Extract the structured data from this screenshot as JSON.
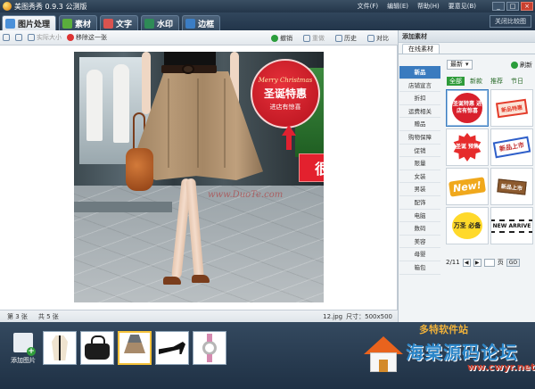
{
  "window": {
    "title": "美图秀秀 0.9.3 公测版",
    "menus": [
      "文件(F)",
      "编辑(E)",
      "帮助(H)",
      "要意见(B)"
    ],
    "controls": [
      "_",
      "□",
      "×"
    ]
  },
  "tabs": [
    {
      "label": "图片处理",
      "icon_color": "#4a90d9"
    },
    {
      "label": "素材",
      "icon_color": "#5aae3c"
    },
    {
      "label": "文字",
      "icon_color": "#d9534f"
    },
    {
      "label": "水印",
      "icon_color": "#2e8b57"
    },
    {
      "label": "边框",
      "icon_color": "#3b7dc4"
    }
  ],
  "close_compare": "关闭比较图",
  "toolbar": {
    "actual_size": "实际大小",
    "remove": "移除这一张",
    "undo": "撤销",
    "redo": "重做",
    "history": "历史",
    "compare": "对比"
  },
  "canvas": {
    "promo_en": "Merry Christmas",
    "promo_main": "圣诞特惠",
    "promo_sub": "进店有惊喜",
    "eye_banner": "很醒目哦",
    "watermark": "www.DuoTe.com"
  },
  "status": {
    "current": "第 3 张",
    "total": "共 5 张",
    "filename": "12.jpg",
    "size": "尺寸：500x500"
  },
  "panel": {
    "title": "添加素材",
    "tab": "在线素材",
    "sort": "最新",
    "refresh": "刷新",
    "subtabs": [
      "全部",
      "新款",
      "推荐",
      "节日"
    ],
    "categories": [
      "新品",
      "店铺宣言",
      "折扣",
      "运费相关",
      "赠品",
      "购物保障",
      "促销",
      "限量",
      "女装",
      "男装",
      "配饰",
      "电脑",
      "数码",
      "美容",
      "母婴",
      "箱包"
    ],
    "stickers": [
      {
        "text": "圣诞特惠 进店有惊喜",
        "style": "st-redcircle"
      },
      {
        "text": "新品特惠",
        "style": "st-redtag"
      },
      {
        "text": "圣诞 预售",
        "style": "st-burst"
      },
      {
        "text": "新品上市",
        "style": "st-bluetag"
      },
      {
        "text": "New!",
        "style": "st-new"
      },
      {
        "text": "新品上市",
        "style": "st-wood"
      },
      {
        "text": "万圣 必备",
        "style": "st-yellow"
      },
      {
        "text": "NEW ARRIVE",
        "style": "st-bw"
      }
    ],
    "pager": {
      "current": "2/11",
      "unit": "页",
      "go": "GO"
    }
  },
  "bottom": {
    "add_label": "添加图片",
    "thumbnails": [
      "coat",
      "handbag",
      "skirt",
      "heel",
      "watch"
    ],
    "active_index": 2,
    "watermark_logo": "多特软件站",
    "watermark_domain": "海棠源码论坛",
    "watermark_url": "ww.cwyr.net"
  },
  "colors": {
    "accent": "#3a7bbf",
    "promo_red": "#e3212e",
    "dark_chrome": "#24364a"
  }
}
